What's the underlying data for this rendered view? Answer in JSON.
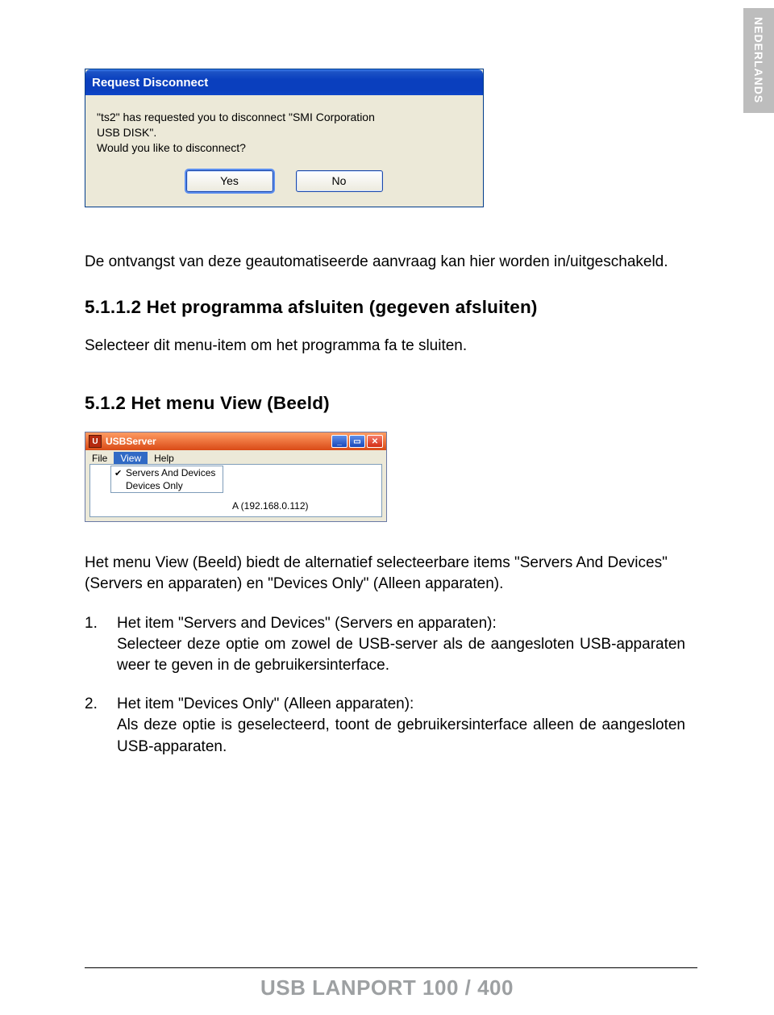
{
  "side_tab": {
    "label": "NEDERLANDS"
  },
  "dialog": {
    "title": "Request Disconnect",
    "line1": "\"ts2\" has requested you to disconnect \"SMI Corporation",
    "line2": "USB DISK\".",
    "line3": "Would you like to disconnect?",
    "yes": "Yes",
    "no": "No"
  },
  "intro": "De ontvangst van deze geautomatiseerde aanvraag kan hier worden in/uitgeschakeld.",
  "sect1": {
    "title": "5.1.1.2 Het programma afsluiten (gegeven afsluiten)",
    "body": "Selecteer dit menu-item om het programma fa te sluiten."
  },
  "sect2": {
    "title": "5.1.2 Het menu View (Beeld)"
  },
  "usbwin": {
    "app_title": "USBServer",
    "menu": {
      "file": "File",
      "view": "View",
      "help": "Help"
    },
    "dropdown": {
      "opt1": "Servers And Devices",
      "opt2": "Devices Only"
    },
    "ip": "A (192.168.0.112)"
  },
  "view_desc": "Het menu View (Beeld) biedt de alternatief selecteerbare items \"Servers And Devices\" (Servers en apparaten) en \"Devices Only\" (Alleen apparaten).",
  "list": {
    "item1": {
      "num": "1.",
      "title": "Het item \"Servers and Devices\" (Servers en apparaten):",
      "body": "Selecteer deze optie om zowel de USB-server als de aangesloten USB-apparaten weer te geven in de gebruikersinterface."
    },
    "item2": {
      "num": "2.",
      "title": "Het item \"Devices Only\" (Alleen apparaten):",
      "body": "Als deze optie is geselecteerd, toont de gebruikersinterface alleen de aangesloten USB-apparaten."
    }
  },
  "footer": "USB LANPORT 100 / 400"
}
